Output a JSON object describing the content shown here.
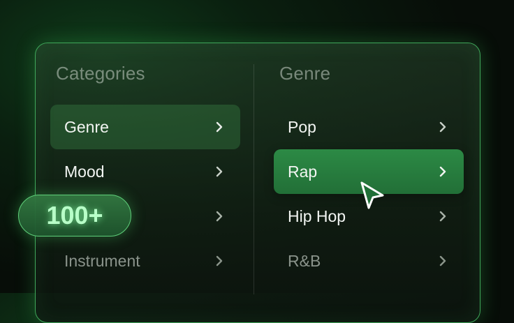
{
  "categories": {
    "heading": "Categories",
    "items": [
      {
        "label": "Genre"
      },
      {
        "label": "Mood"
      },
      {
        "label": ""
      },
      {
        "label": "Instrument"
      }
    ]
  },
  "genre": {
    "heading": "Genre",
    "items": [
      {
        "label": "Pop"
      },
      {
        "label": "Rap"
      },
      {
        "label": "Hip Hop"
      },
      {
        "label": "R&B"
      }
    ]
  },
  "badge": {
    "text": "100+"
  },
  "colors": {
    "accent": "#2c8a45",
    "border": "#3fa75a",
    "badge_glow": "#b8ffc8"
  },
  "icons": {
    "chevron": "chevron-right-icon",
    "pointer": "mouse-pointer-icon"
  }
}
